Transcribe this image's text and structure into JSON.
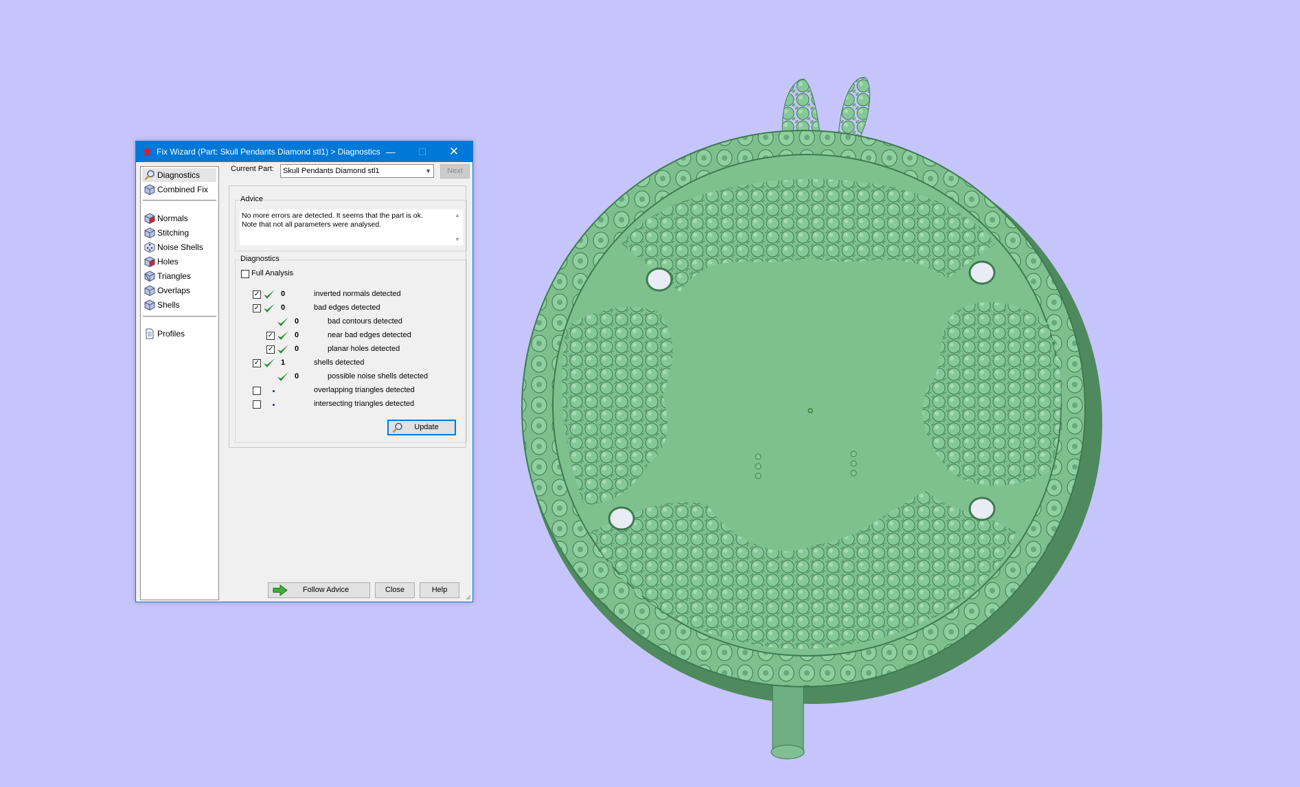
{
  "dialog": {
    "title": "Fix Wizard (Part: Skull Pendants Diamond stl1) > Diagnostics",
    "window_controls": {
      "minimize": "—",
      "maximize": "☐",
      "close": "✕"
    }
  },
  "sidebar": {
    "items": [
      {
        "label": "Diagnostics",
        "icon": "magnifier-icon",
        "selected": true
      },
      {
        "label": "Combined Fix",
        "icon": "cube-icon"
      },
      {
        "label": "Normals",
        "icon": "cube-red-icon"
      },
      {
        "label": "Stitching",
        "icon": "cube-icon"
      },
      {
        "label": "Noise Shells",
        "icon": "dice-icon"
      },
      {
        "label": "Holes",
        "icon": "cube-red-icon"
      },
      {
        "label": "Triangles",
        "icon": "cube-icon"
      },
      {
        "label": "Overlaps",
        "icon": "cube-icon"
      },
      {
        "label": "Shells",
        "icon": "cube-icon"
      },
      {
        "label": "Profiles",
        "icon": "document-icon"
      }
    ]
  },
  "part": {
    "label": "Current Part:",
    "value": "Skull Pendants Diamond stl1",
    "next_label": "Next"
  },
  "advice": {
    "title": "Advice",
    "text": "No more errors are detected. It seems that the part is ok.\nNote that not all parameters were analysed."
  },
  "diagnostics": {
    "title": "Diagnostics",
    "full_analysis_label": "Full Analysis",
    "full_analysis_checked": false,
    "rows": [
      {
        "checkbox": true,
        "checked": true,
        "status": "ok",
        "count": "0",
        "label": "inverted normals detected"
      },
      {
        "checkbox": true,
        "checked": true,
        "status": "ok",
        "count": "0",
        "label": "bad edges detected"
      },
      {
        "checkbox": false,
        "checked": false,
        "status": "ok",
        "count": "0",
        "label": "bad contours detected"
      },
      {
        "checkbox": true,
        "checked": true,
        "status": "ok",
        "count": "0",
        "label": "near bad edges detected"
      },
      {
        "checkbox": true,
        "checked": true,
        "status": "ok",
        "count": "0",
        "label": "planar holes detected"
      },
      {
        "checkbox": true,
        "checked": true,
        "status": "ok",
        "count": "1",
        "label": "shells detected"
      },
      {
        "checkbox": false,
        "checked": false,
        "status": "ok",
        "count": "0",
        "label": "possible noise shells detected"
      },
      {
        "checkbox": true,
        "checked": false,
        "status": "none",
        "count": "",
        "label": "overlapping triangles detected"
      },
      {
        "checkbox": true,
        "checked": false,
        "status": "none",
        "count": "",
        "label": "intersecting triangles detected"
      }
    ],
    "update_label": "Update"
  },
  "footer": {
    "follow_advice_label": "Follow Advice",
    "close_label": "Close",
    "help_label": "Help"
  },
  "colors": {
    "background": "#c5c5fb",
    "titlebar": "#0078d7",
    "model_green": "#7fc08f",
    "check_green": "#2e8b3a"
  }
}
